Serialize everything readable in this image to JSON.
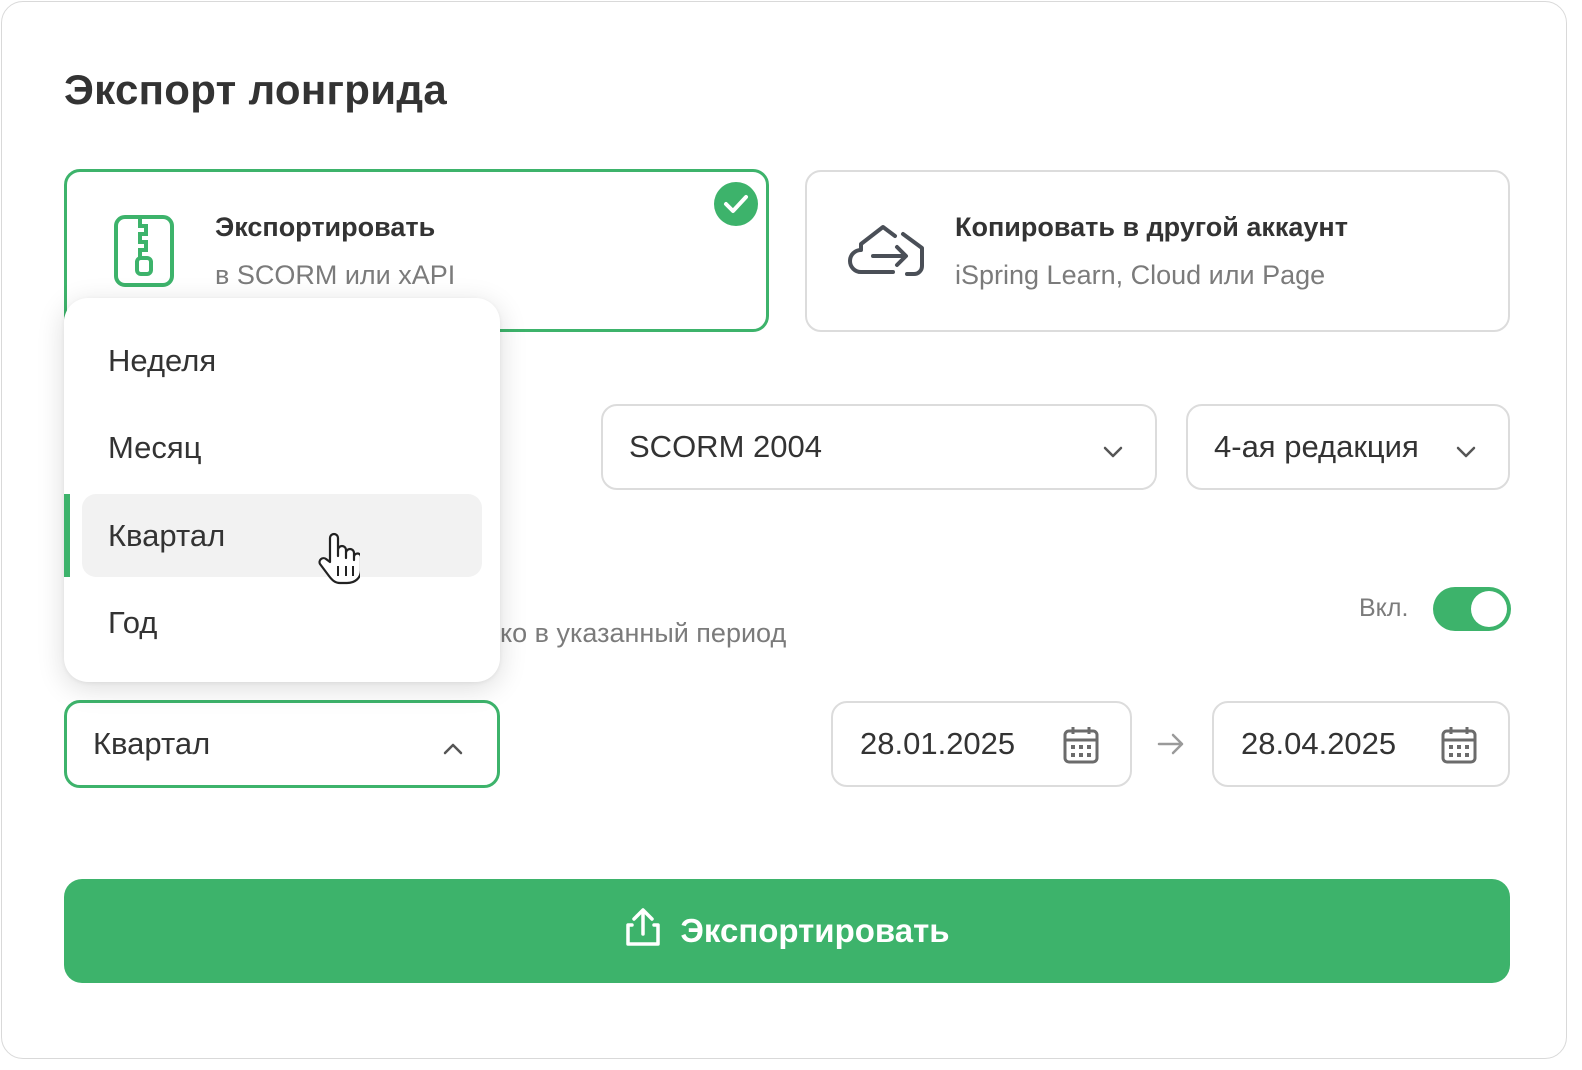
{
  "dialog": {
    "title": "Экспорт лонгрида"
  },
  "options": {
    "export": {
      "title": "Экспортировать",
      "subtitle": "в SCORM или xAPI",
      "selected": true
    },
    "copy": {
      "title": "Копировать в другой аккаунт",
      "subtitle": "iSpring Learn, Cloud или Page",
      "selected": false
    }
  },
  "format": {
    "standard": "SCORM 2004",
    "edition": "4-ая редакция"
  },
  "period_filter": {
    "description_partial": "ко в указанный период",
    "toggle_label": "Вкл.",
    "toggle_on": true
  },
  "period_select": {
    "value": "Квартал",
    "open": true,
    "options": [
      "Неделя",
      "Месяц",
      "Квартал",
      "Год"
    ],
    "highlighted_index": 2
  },
  "dates": {
    "from": "28.01.2025",
    "to": "28.04.2025"
  },
  "export_button": {
    "label": "Экспортировать"
  },
  "colors": {
    "accent": "#3db36b",
    "border": "#dcdcdc",
    "muted_text": "#7b7b7b"
  },
  "icons": {
    "export_card": "zip-file-icon",
    "copy_card": "cloud-transfer-icon",
    "selected_badge": "check-circle-icon",
    "select_chevron": "chevron-down-icon",
    "period_chevron": "chevron-up-icon",
    "date_picker": "calendar-icon",
    "range_separator": "arrow-right-icon",
    "export_button": "upload-icon",
    "pointer": "hand-cursor-icon"
  }
}
